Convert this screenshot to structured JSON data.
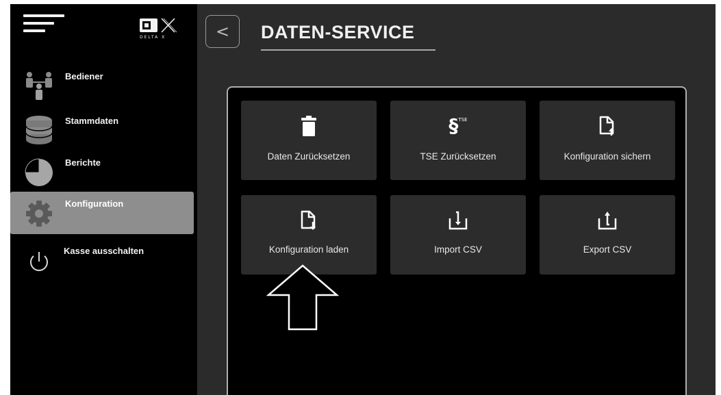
{
  "brand": {
    "logo_mark": "DX",
    "logo_text": "DELTA X"
  },
  "sidebar": {
    "items": [
      {
        "label": "Bediener",
        "icon": "users-icon"
      },
      {
        "label": "Stammdaten",
        "icon": "database-icon"
      },
      {
        "label": "Berichte",
        "icon": "pie-chart-icon"
      },
      {
        "label": "Konfiguration",
        "icon": "gear-icon",
        "active": true
      },
      {
        "label": "Kasse ausschalten",
        "icon": "power-icon"
      }
    ]
  },
  "header": {
    "back_label": "<",
    "title": "DATEN-SERVICE"
  },
  "tiles": [
    {
      "label": "Daten Zurücksetzen",
      "icon": "trash-icon"
    },
    {
      "label": "TSE Zurücksetzen",
      "icon": "tse-paragraph-icon",
      "icon_text": "§",
      "icon_sup": "TSE"
    },
    {
      "label": "Konfiguration sichern",
      "icon": "file-upload-icon"
    },
    {
      "label": "Konfiguration laden",
      "icon": "file-download-icon"
    },
    {
      "label": "Import CSV",
      "icon": "import-icon"
    },
    {
      "label": "Export CSV",
      "icon": "export-icon"
    }
  ],
  "colors": {
    "background": "#000000",
    "main_background": "#2b2b2b",
    "tile_background": "#2c2c2c",
    "active_nav": "#8e8e8e",
    "text": "#f2f2f2"
  }
}
